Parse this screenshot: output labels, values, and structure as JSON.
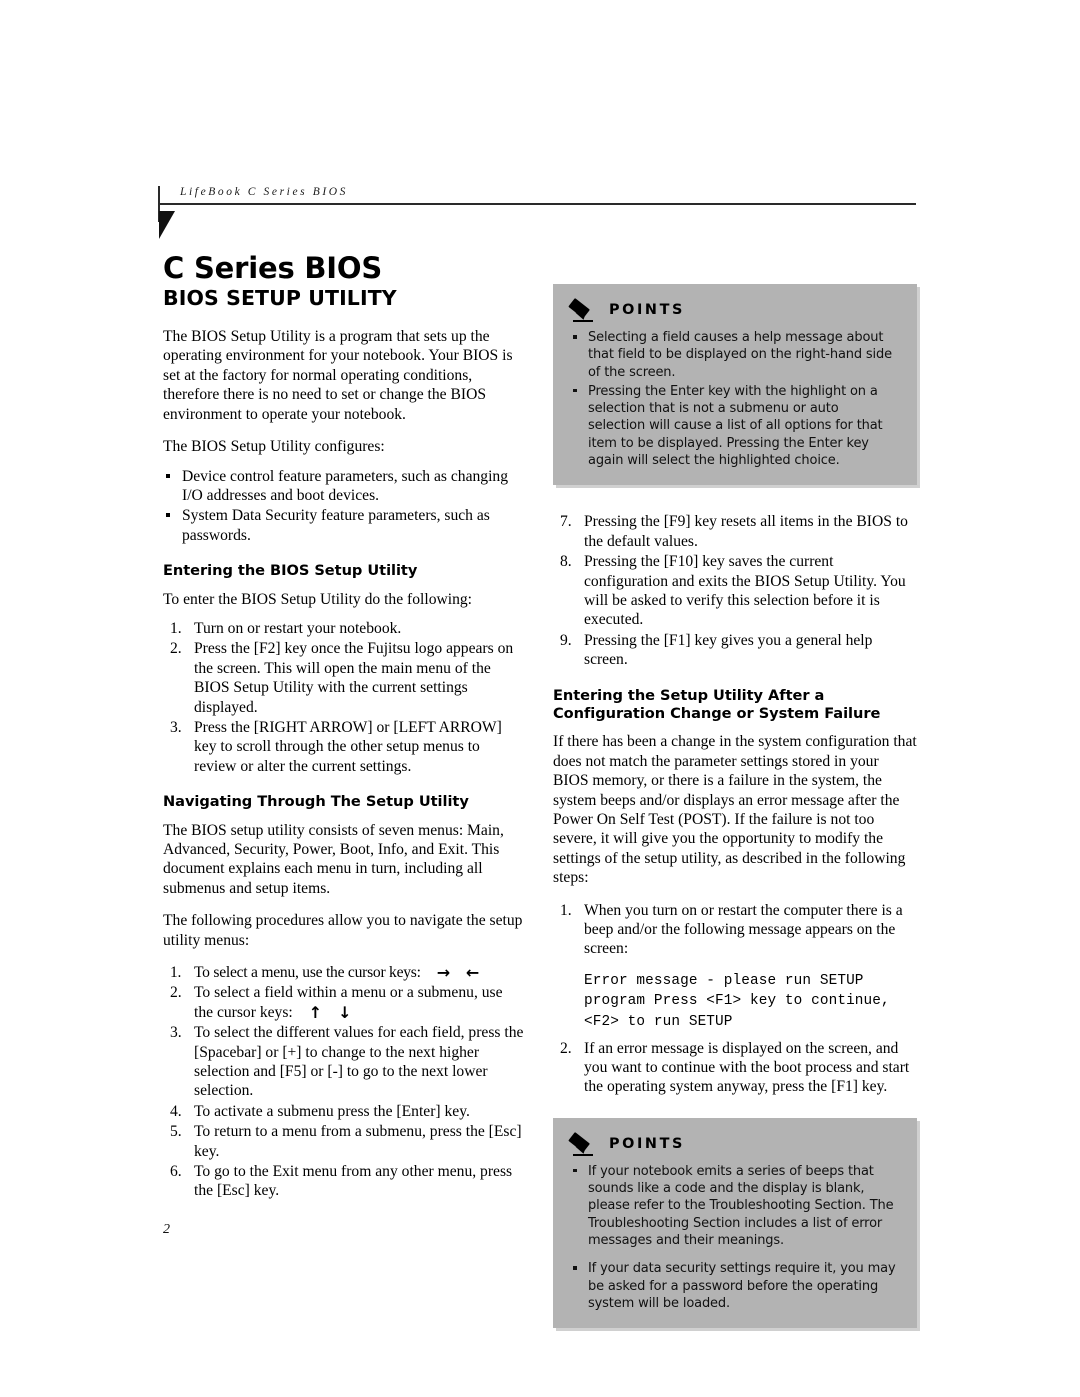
{
  "header": {
    "running_head": "LifeBook C Series BIOS"
  },
  "titles": {
    "doc_title": "C Series BIOS",
    "doc_subtitle": "BIOS SETUP UTILITY"
  },
  "left_column": {
    "intro_paragraph_1": "The BIOS Setup Utility is a program that sets up the operating environment for your notebook. Your BIOS is set at the factory for normal operating conditions, therefore there is no need to set or change the BIOS environment to operate your notebook.",
    "intro_paragraph_2": "The BIOS Setup Utility configures:",
    "config_bullets": [
      "Device control feature parameters, such as changing I/O addresses and boot devices.",
      "System Data Security feature parameters, such as passwords."
    ],
    "entering_heading": "Entering the BIOS Setup Utility",
    "entering_lead": "To enter the BIOS Setup Utility do the following:",
    "entering_steps": [
      "Turn on or restart your notebook.",
      "Press the [F2] key once the Fujitsu logo appears on the screen. This will open the main menu of the BIOS Setup Utility with the current settings displayed.",
      "Press the [RIGHT ARROW] or [LEFT ARROW] key to scroll through the other setup menus to review or alter the current settings."
    ],
    "navigating_heading": "Navigating Through The Setup Utility",
    "navigating_paragraph_1": "The BIOS setup utility consists of seven menus: Main, Advanced, Security, Power, Boot, Info, and Exit. This document explains each menu in turn, including all submenus and setup items.",
    "navigating_paragraph_2": "The following procedures allow you to navigate the setup utility menus:",
    "nav_step_1_text": "To select a menu, use the cursor keys:",
    "nav_step_1_icon_right": "right-arrow-icon",
    "nav_step_1_icon_left": "left-arrow-icon",
    "nav_step_1_glyph_right": "→",
    "nav_step_1_glyph_left": "←",
    "nav_step_2_text": "To select a field within a menu or a submenu, use the cursor keys:",
    "nav_step_2_icon_up": "up-arrow-icon",
    "nav_step_2_icon_down": "down-arrow-icon",
    "nav_step_2_glyph_up": "↑",
    "nav_step_2_glyph_down": "↓",
    "nav_steps_rest": [
      "To select the different values for each field, press the [Spacebar] or [+] to change to the next higher selection and [F5] or [-] to go to the next lower selection.",
      "To activate a submenu press the [Enter] key.",
      "To return to a menu from a submenu, press the [Esc] key.",
      "To go to the Exit menu from any other menu, press the [Esc] key."
    ]
  },
  "right_column": {
    "points_box_1": {
      "title": "POINTS",
      "icon": "pencil-icon",
      "items": [
        "Selecting a field causes a help message about that field to be displayed on the right-hand side of the screen.",
        "Pressing the Enter key with the highlight on a selection that is not a submenu or auto selection will cause a list of all options for that item to be displayed. Pressing the Enter key again will select the highlighted choice."
      ]
    },
    "nav_steps_continued": [
      "Pressing the [F9] key resets all items in the BIOS to the default values.",
      "Pressing the [F10] key saves the current configuration and exits the BIOS Setup Utility. You will be asked to verify this selection before it is executed.",
      "Pressing the [F1] key gives you a general help screen."
    ],
    "failure_heading": "Entering the Setup Utility After a Configuration Change or System Failure",
    "failure_paragraph": "If there has been a change in the system configuration that does not match the parameter settings stored in your BIOS memory, or there is a failure in the system, the system beeps and/or displays an error message after the Power On Self Test (POST). If the failure is not too severe, it will give you the opportunity to modify the settings of the setup utility, as described in the following steps:",
    "failure_step_1": "When you turn on or restart the computer there is a beep and/or the following message appears on the screen:",
    "error_message_code": "Error message - please run SETUP\nprogram Press <F1> key to continue,\n<F2> to run SETUP",
    "failure_step_2": "If an error message is displayed on the screen, and you want to continue with the boot process and start the operating system anyway, press the [F1] key.",
    "points_box_2": {
      "title": "POINTS",
      "icon": "pencil-icon",
      "items": [
        "If your notebook emits a series of beeps that sounds like a code and the display is blank, please refer to the Troubleshooting Section. The Troubleshooting Section includes a list of error messages and their meanings.",
        "If your data security settings require it, you may be asked for a password before the operating system will be loaded."
      ]
    }
  },
  "footer": {
    "page_number": "2"
  },
  "colors": {
    "points_box_background": "#b3b3b3",
    "text": "#000000",
    "rule": "#2a2a2a"
  }
}
